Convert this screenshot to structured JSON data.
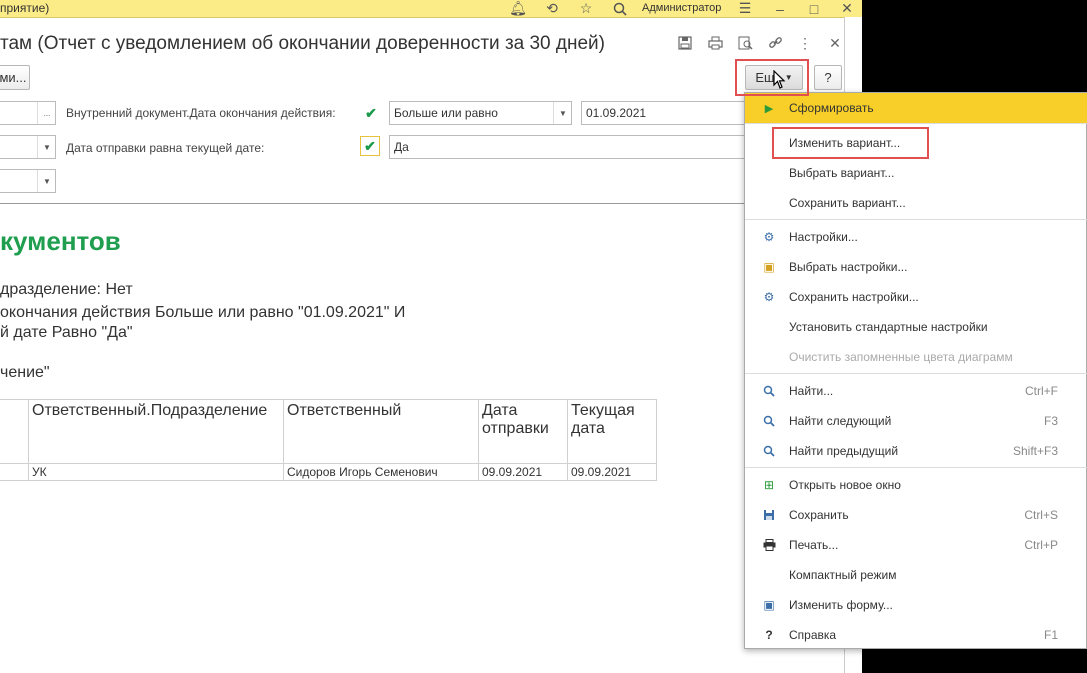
{
  "titlebar": {
    "app_title": "приятие)",
    "user": "Администратор"
  },
  "form": {
    "title": "там (Отчет с уведомлением об окончании доверенности за 30 дней)",
    "left_button": "ми...",
    "more_button": "Ещ",
    "help_button": "?"
  },
  "filters": {
    "ellipsis": "...",
    "row1_label": "Внутренний документ.Дата окончания действия:",
    "row1_condition": "Больше или равно",
    "row1_value": "01.09.2021",
    "row2_label": "Дата отправки равна текущей дате:",
    "row2_value": "Да"
  },
  "report": {
    "title": "кументов",
    "line1": "дразделение: Нет",
    "line2": "окончания действия Больше или равно \"01.09.2021\" И",
    "line3": "й дате Равно \"Да\"",
    "line4": "чение\"",
    "columns": [
      "Ответственный.Подразделение",
      "Ответственный",
      "Дата отправки",
      "Текущая дата"
    ],
    "col_sub": [
      "",
      "",
      "отправки",
      "дата"
    ],
    "col_head": [
      "Ответственный.Подразделение",
      "Ответственный",
      "Дата",
      "Текущая"
    ],
    "rows": [
      [
        "УК",
        "Сидоров Игорь Семенович",
        "09.09.2021",
        "09.09.2021"
      ]
    ]
  },
  "menu": {
    "items": [
      {
        "label": "Сформировать",
        "key": ""
      },
      {
        "label": "Изменить вариант...",
        "key": ""
      },
      {
        "label": "Выбрать вариант...",
        "key": ""
      },
      {
        "label": "Сохранить вариант...",
        "key": ""
      },
      {
        "label": "Настройки...",
        "key": ""
      },
      {
        "label": "Выбрать настройки...",
        "key": ""
      },
      {
        "label": "Сохранить настройки...",
        "key": ""
      },
      {
        "label": "Установить стандартные настройки",
        "key": ""
      },
      {
        "label": "Очистить запомненные цвета диаграмм",
        "key": ""
      },
      {
        "label": "Найти...",
        "key": "Ctrl+F"
      },
      {
        "label": "Найти следующий",
        "key": "F3"
      },
      {
        "label": "Найти предыдущий",
        "key": "Shift+F3"
      },
      {
        "label": "Открыть новое окно",
        "key": ""
      },
      {
        "label": "Сохранить",
        "key": "Ctrl+S"
      },
      {
        "label": "Печать...",
        "key": "Ctrl+P"
      },
      {
        "label": "Компактный режим",
        "key": ""
      },
      {
        "label": "Изменить форму...",
        "key": ""
      },
      {
        "label": "Справка",
        "key": "F1"
      }
    ]
  },
  "colors": {
    "titlebar_bg": "#fbec88",
    "highlight": "#f7cf28",
    "report_title": "#1e9e4e",
    "annotation": "#e05050"
  }
}
